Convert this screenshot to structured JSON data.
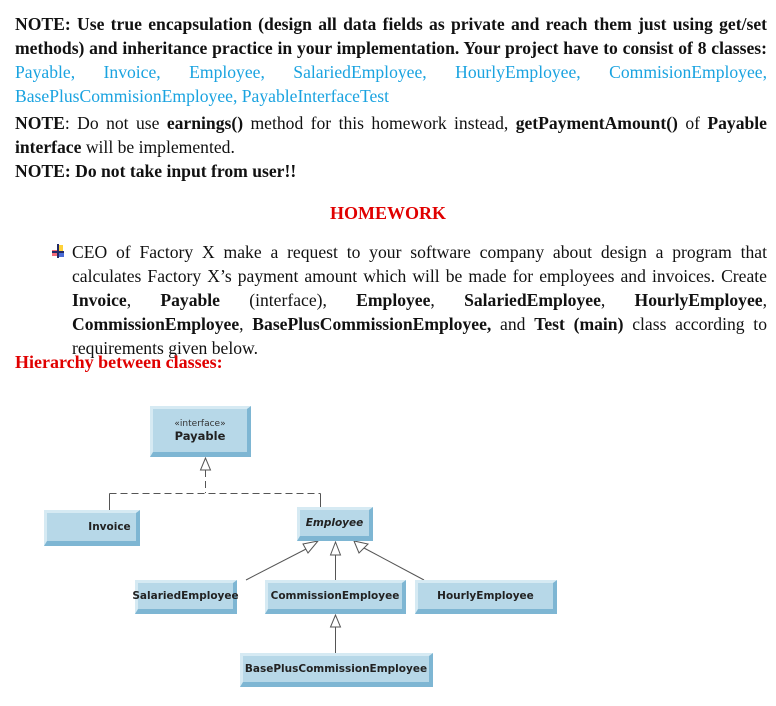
{
  "notes": {
    "note1": {
      "prefix": "NOTE: Use true encapsulation (design all data fields as private and reach them just using get/set methods) and inheritance practice in your implementation. Your project have to consist of 8 classes:",
      "classes": "Payable, Invoice, Employee, SalariedEmployee, HourlyEmployee, CommisionEmployee, BasePlusCommisionEmployee, PayableInterfaceTest"
    },
    "note2": {
      "label": "NOTE",
      "text1": ": Do not use ",
      "earnings": "earnings()",
      "text2": " method for this homework instead, ",
      "getPayment": "getPaymentAmount()",
      "text3": " of ",
      "payable_iface": "Payable interface",
      "text4": " will be implemented."
    },
    "note3": "NOTE: Do not take input from user!!"
  },
  "homework": {
    "title": "HOMEWORK",
    "bullet_icon": "colored-plus-bullet",
    "paragraph": {
      "t1": "CEO of Factory X make a request to your software company about design a program that calculates Factory X’s payment amount which will be made for employees and invoices. Create ",
      "invoice": "Invoice",
      "t2": ", ",
      "payable": "Payable",
      "t3": " (interface), ",
      "employee": "Employee",
      "t4": ", ",
      "salaried": "SalariedEmployee",
      "t5": ", ",
      "hourly": "HourlyEmployee",
      "t6": ", ",
      "commission": "CommissionEmployee",
      "t7": ", ",
      "baseplus": "BasePlusCommissionEmployee,",
      "t8": " and ",
      "test": "Test (main)",
      "t9": " class according to requirements given below."
    },
    "hierarchy_title": "Hierarchy between classes:"
  },
  "diagram": {
    "payable": {
      "stereotype": "«interface»",
      "name": "Payable"
    },
    "invoice": "Invoice",
    "employee": "Employee",
    "salaried": "SalariedEmployee",
    "commission": "CommissionEmployee",
    "hourly": "HourlyEmployee",
    "baseplus": "BasePlusCommissionEmployee"
  },
  "colors": {
    "class_list": "#1aa3e0",
    "heading_red": "#e00000",
    "box_fill": "#b7d8e8"
  }
}
